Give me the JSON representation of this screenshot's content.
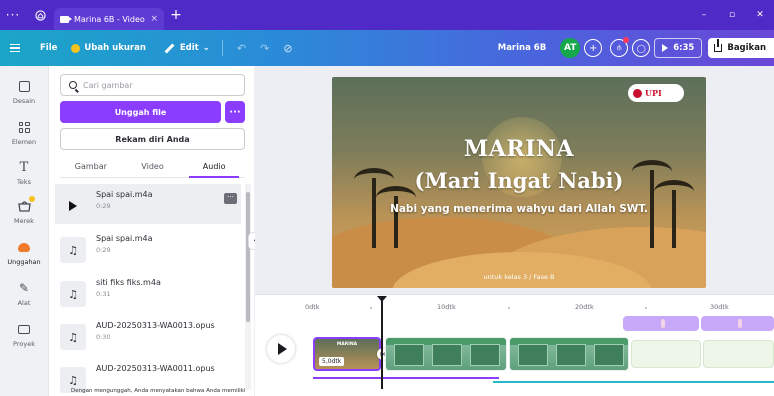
{
  "browser": {
    "tab_title": "Marina 6B - Video",
    "tab_close": "×",
    "new_tab": "+",
    "menu_dots": "···",
    "win_minimize": "–",
    "win_maximize": "▫",
    "win_close": "✕"
  },
  "toolbar": {
    "file": "File",
    "resize": "Ubah ukuran",
    "edit": "Edit",
    "edit_chevron": "⌄",
    "undo": "↶",
    "redo": "↷",
    "sync": "⊘",
    "project_name": "Marina 6B",
    "avatar": "AT",
    "add_collab": "+",
    "analytics": "⫛",
    "comment": "◯",
    "duration": "6:35",
    "share": "Bagikan"
  },
  "rail": {
    "items": [
      {
        "label": "Desain",
        "icon": "design-icon"
      },
      {
        "label": "Elemen",
        "icon": "elements-icon"
      },
      {
        "label": "Teks",
        "icon": "text-icon",
        "glyph": "T"
      },
      {
        "label": "Merek",
        "icon": "brand-icon"
      },
      {
        "label": "Unggahan",
        "icon": "uploads-icon"
      },
      {
        "label": "Alat",
        "icon": "tools-icon",
        "glyph": "✎"
      },
      {
        "label": "Proyek",
        "icon": "projects-icon"
      }
    ]
  },
  "panel": {
    "search_placeholder": "Cari gambar",
    "upload_label": "Unggah file",
    "more_label": "···",
    "record_label": "Rekam diri Anda",
    "tabs": [
      {
        "label": "Gambar",
        "active": false
      },
      {
        "label": "Video",
        "active": false
      },
      {
        "label": "Audio",
        "active": true
      }
    ],
    "audio_items": [
      {
        "name": "Spai spai.m4a",
        "duration": "0:29",
        "selected": true
      },
      {
        "name": "Spai spai.m4a",
        "duration": "0:29",
        "selected": false
      },
      {
        "name": "siti fiks fiks.m4a",
        "duration": "0:31",
        "selected": false
      },
      {
        "name": "AUD-20250313-WA0013.opus",
        "duration": "0:30",
        "selected": false
      },
      {
        "name": "AUD-20250313-WA0011.opus",
        "duration": "",
        "selected": false
      }
    ],
    "row_more": "···",
    "play_glyph": "▶",
    "note_glyph": "♫",
    "footer_note": "Dengan mengunggah, Anda menyatakan bahwa Anda memiliki",
    "collapse": "‹"
  },
  "slide": {
    "logo_text": "UPI",
    "title": "MARINA",
    "subtitle": "(Mari Ingat Nabi)",
    "description": "Nabi yang menerima wahyu dari Allah SWT.",
    "class_label": "untuk kelas 3 / Fase B",
    "colors": {
      "sky_top": "#5c6f5a",
      "sand": "#d9a85a"
    }
  },
  "timeline": {
    "ticks": [
      {
        "label": "0dtk"
      },
      {
        "label": "10dtk"
      },
      {
        "label": "20dtk"
      },
      {
        "label": "30dtk"
      }
    ],
    "first_clip_duration": "5,0dtk",
    "first_clip_caption": "MARINA",
    "transition_glyph": "⋈"
  },
  "colors": {
    "accent": "#8b3dff",
    "tabbar": "#4f2ac6",
    "audio_track_teal": "#25b9c7"
  }
}
